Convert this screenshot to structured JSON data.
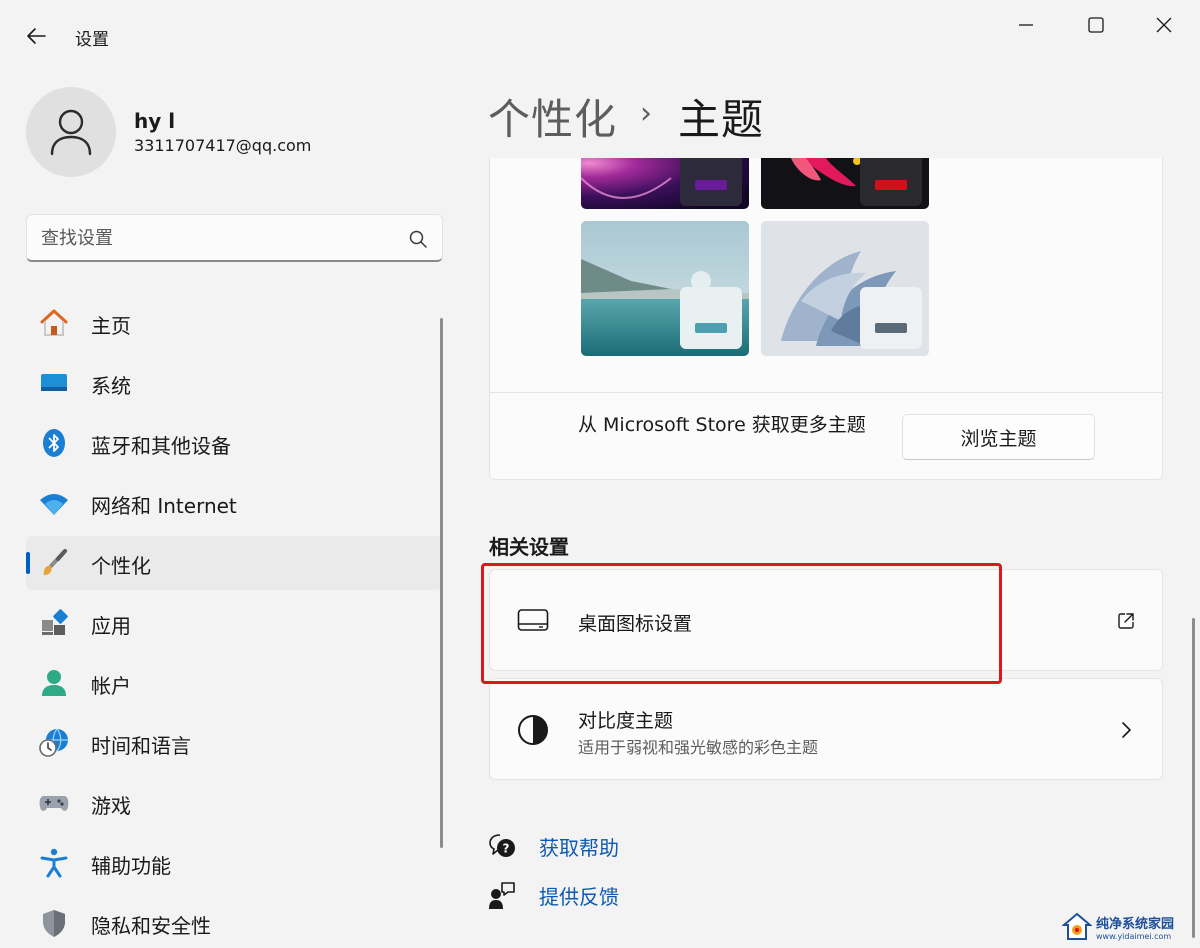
{
  "app": {
    "title": "设置"
  },
  "profile": {
    "name": "hy l",
    "email": "3311707417@qq.com"
  },
  "search": {
    "placeholder": "查找设置"
  },
  "sidebar": {
    "items": [
      {
        "label": "主页",
        "icon": "home-icon",
        "selected": false
      },
      {
        "label": "系统",
        "icon": "display-icon",
        "selected": false
      },
      {
        "label": "蓝牙和其他设备",
        "icon": "bluetooth-icon",
        "selected": false
      },
      {
        "label": "网络和 Internet",
        "icon": "wifi-icon",
        "selected": false
      },
      {
        "label": "个性化",
        "icon": "paintbrush-icon",
        "selected": true
      },
      {
        "label": "应用",
        "icon": "apps-icon",
        "selected": false
      },
      {
        "label": "帐户",
        "icon": "person-icon",
        "selected": false
      },
      {
        "label": "时间和语言",
        "icon": "clock-globe-icon",
        "selected": false
      },
      {
        "label": "游戏",
        "icon": "gamepad-icon",
        "selected": false
      },
      {
        "label": "辅助功能",
        "icon": "accessibility-icon",
        "selected": false
      },
      {
        "label": "隐私和安全性",
        "icon": "shield-icon",
        "selected": false
      }
    ]
  },
  "breadcrumb": {
    "parent": "个性化",
    "separator": "›",
    "current": "主题"
  },
  "themes": {
    "store_text": "从 Microsoft Store 获取更多主题",
    "browse_button": "浏览主题",
    "accent_colors": [
      "#6a1b9a",
      "#d0101a",
      "#4d9fb0",
      "#5a6a78"
    ]
  },
  "related": {
    "title": "相关设置",
    "desktop_icons": {
      "title": "桌面图标设置",
      "icon": "monitor-icon",
      "trail_icon": "open-external-icon"
    },
    "contrast": {
      "title": "对比度主题",
      "subtitle": "适用于弱视和强光敏感的彩色主题",
      "icon": "contrast-icon",
      "trail_icon": "chevron-right-icon"
    }
  },
  "help": {
    "get_help": "获取帮助",
    "feedback": "提供反馈"
  },
  "watermark": {
    "main": "纯净系统家园",
    "url": "www.yidaimei.com"
  },
  "colors": {
    "accent": "#005fb8",
    "link": "#0e5ab0",
    "highlight": "#e0161c"
  }
}
